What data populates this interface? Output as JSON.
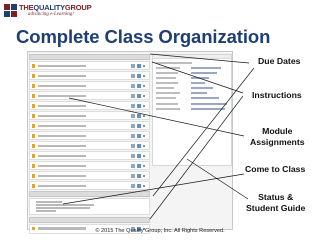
{
  "logo": {
    "name_prefix": "THE",
    "name_highlight": "QUALITY",
    "name_suffix": "GROUP",
    "tagline": "advancing e-Learning!"
  },
  "slide": {
    "title": "Complete Class Organization"
  },
  "callouts": {
    "due_dates": "Due Dates",
    "instructions": "Instructions",
    "module_line1": "Module",
    "module_line2": "Assignments",
    "come_to_class": "Come to Class",
    "status_line1": "Status &",
    "status_line2": "Student Guide"
  },
  "footer": {
    "copyright": "© 2015 The Quality Group, Inc. All Rights Reserved."
  },
  "colors": {
    "title": "#1f3f74",
    "logo_red": "#7a1e2a",
    "item_icon": "#e2a43a"
  }
}
